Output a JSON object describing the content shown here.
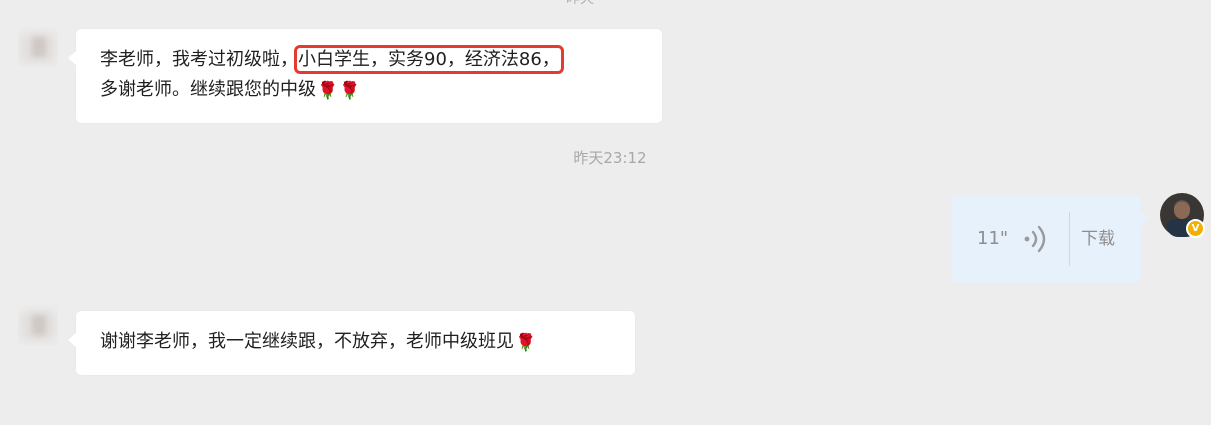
{
  "chat": {
    "top_time_fragment": "昨天",
    "messages": [
      {
        "sender": "other",
        "line1_before": "李老师，我考过初级啦，",
        "line1_highlight": "小白学生，实务90，经济法86，",
        "line2_text": "多谢老师。继续跟您的中级",
        "emojis": [
          "🌹",
          "🌹"
        ]
      },
      {
        "sender": "self",
        "type": "voice",
        "timestamp": "昨天23:12",
        "duration": "11\"",
        "download_label": "下载",
        "icon": "voice-wave-icon"
      },
      {
        "sender": "other",
        "text": "谢谢李老师，我一定继续跟，不放弃，老师中级班见",
        "emojis": [
          "🌹"
        ]
      }
    ]
  },
  "colors": {
    "background": "#ededed",
    "bubble_other": "#ffffff",
    "bubble_self": "#e7f1fb",
    "highlight_border": "#e53b2f",
    "timestamp": "#a8a8a8",
    "vip_badge": "#f4b000"
  },
  "avatar_badge": "V"
}
